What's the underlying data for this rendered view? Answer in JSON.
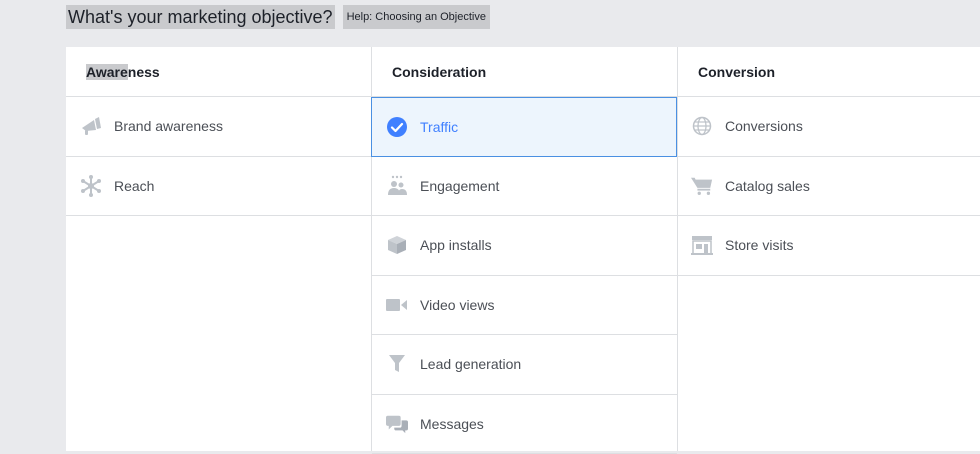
{
  "header": {
    "title": "What's your marketing objective?",
    "help_link": "Help: Choosing an Objective"
  },
  "columns": [
    {
      "heading_highlight": "Aware",
      "heading_rest": "ness",
      "items": [
        {
          "label": "Brand awareness",
          "icon": "megaphone-icon"
        },
        {
          "label": "Reach",
          "icon": "reach-asterisk-icon"
        }
      ]
    },
    {
      "heading": "Consideration",
      "items": [
        {
          "label": "Traffic",
          "icon": "check-circle-icon",
          "selected": true
        },
        {
          "label": "Engagement",
          "icon": "people-icon"
        },
        {
          "label": "App installs",
          "icon": "box-icon"
        },
        {
          "label": "Video views",
          "icon": "video-camera-icon"
        },
        {
          "label": "Lead generation",
          "icon": "funnel-icon"
        },
        {
          "label": "Messages",
          "icon": "chat-bubbles-icon"
        }
      ]
    },
    {
      "heading": "Conversion",
      "items": [
        {
          "label": "Conversions",
          "icon": "globe-icon"
        },
        {
          "label": "Catalog sales",
          "icon": "shopping-cart-icon"
        },
        {
          "label": "Store visits",
          "icon": "storefront-icon"
        }
      ]
    }
  ],
  "colors": {
    "icon_gray": "#bec3c9",
    "selected_blue": "#4080ff",
    "selected_bg": "#edf5fd",
    "highlight": "#c9cacd"
  }
}
